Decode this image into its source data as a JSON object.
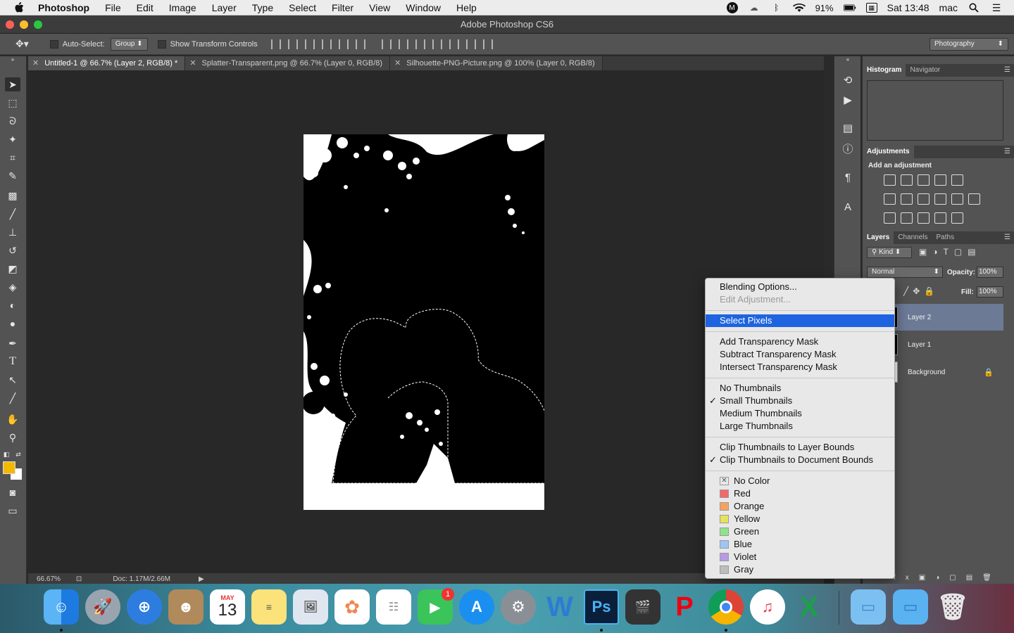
{
  "menubar": {
    "app": "Photoshop",
    "items": [
      "File",
      "Edit",
      "Image",
      "Layer",
      "Type",
      "Select",
      "Filter",
      "View",
      "Window",
      "Help"
    ],
    "battery": "91%",
    "clock": "Sat 13:48",
    "user": "mac"
  },
  "window": {
    "title": "Adobe Photoshop CS6"
  },
  "options": {
    "auto_select_label": "Auto-Select:",
    "auto_select_value": "Group",
    "transform_label": "Show Transform Controls",
    "workspace": "Photography"
  },
  "tabs": [
    {
      "label": "Untitled-1 @ 66.7% (Layer 2, RGB/8) *"
    },
    {
      "label": "Splatter-Transparent.png @ 66.7% (Layer 0, RGB/8)"
    },
    {
      "label": "Silhouette-PNG-Picture.png @ 100% (Layer 0, RGB/8)"
    }
  ],
  "status": {
    "zoom": "66.67%",
    "doc": "Doc: 1.17M/2.66M"
  },
  "panels": {
    "histogram_tab": "Histogram",
    "navigator_tab": "Navigator",
    "adjustments_tab": "Adjustments",
    "add_adjustment": "Add an adjustment",
    "layers_tab": "Layers",
    "channels_tab": "Channels",
    "paths_tab": "Paths",
    "kind": "Kind",
    "blend_mode": "Normal",
    "opacity_label": "Opacity:",
    "opacity_value": "100%",
    "fill_label": "Fill:",
    "fill_value": "100%",
    "layers": [
      "Layer 2",
      "Layer 1",
      "Background"
    ]
  },
  "context_menu": {
    "blending_options": "Blending Options...",
    "edit_adjustment": "Edit Adjustment...",
    "select_pixels": "Select Pixels",
    "add_transparency_mask": "Add Transparency Mask",
    "subtract_transparency_mask": "Subtract Transparency Mask",
    "intersect_transparency_mask": "Intersect Transparency Mask",
    "no_thumbnails": "No Thumbnails",
    "small_thumbnails": "Small Thumbnails",
    "medium_thumbnails": "Medium Thumbnails",
    "large_thumbnails": "Large Thumbnails",
    "clip_layer_bounds": "Clip Thumbnails to Layer Bounds",
    "clip_document_bounds": "Clip Thumbnails to Document Bounds",
    "colors": [
      {
        "name": "No Color",
        "hex": "#e8e8e8"
      },
      {
        "name": "Red",
        "hex": "#f06a6a"
      },
      {
        "name": "Orange",
        "hex": "#f5a35c"
      },
      {
        "name": "Yellow",
        "hex": "#e6e35a"
      },
      {
        "name": "Green",
        "hex": "#8fe48a"
      },
      {
        "name": "Blue",
        "hex": "#9ec6f5"
      },
      {
        "name": "Violet",
        "hex": "#b79ae6"
      },
      {
        "name": "Gray",
        "hex": "#bdbdbd"
      }
    ]
  },
  "dock": {
    "calendar_month": "MAY",
    "calendar_day": "13",
    "facetime_badge": "1"
  },
  "colors": {
    "foreground": "#f5b800",
    "background": "#ffffff",
    "highlight": "#1e64e0"
  }
}
